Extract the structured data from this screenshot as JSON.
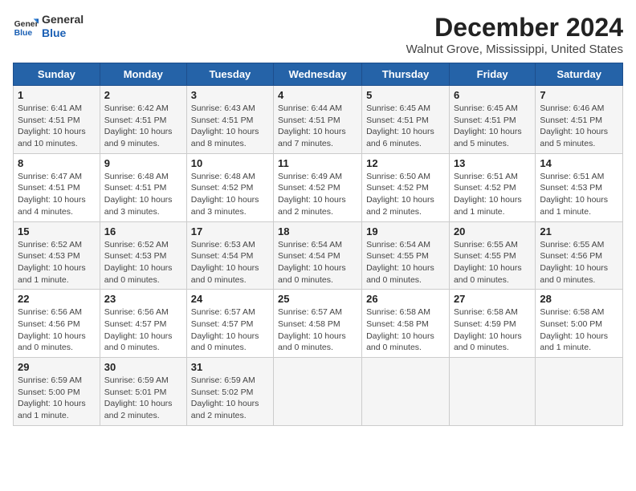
{
  "header": {
    "logo_line1": "General",
    "logo_line2": "Blue",
    "title": "December 2024",
    "subtitle": "Walnut Grove, Mississippi, United States"
  },
  "weekdays": [
    "Sunday",
    "Monday",
    "Tuesday",
    "Wednesday",
    "Thursday",
    "Friday",
    "Saturday"
  ],
  "weeks": [
    [
      {
        "day": "1",
        "info": "Sunrise: 6:41 AM\nSunset: 4:51 PM\nDaylight: 10 hours\nand 10 minutes."
      },
      {
        "day": "2",
        "info": "Sunrise: 6:42 AM\nSunset: 4:51 PM\nDaylight: 10 hours\nand 9 minutes."
      },
      {
        "day": "3",
        "info": "Sunrise: 6:43 AM\nSunset: 4:51 PM\nDaylight: 10 hours\nand 8 minutes."
      },
      {
        "day": "4",
        "info": "Sunrise: 6:44 AM\nSunset: 4:51 PM\nDaylight: 10 hours\nand 7 minutes."
      },
      {
        "day": "5",
        "info": "Sunrise: 6:45 AM\nSunset: 4:51 PM\nDaylight: 10 hours\nand 6 minutes."
      },
      {
        "day": "6",
        "info": "Sunrise: 6:45 AM\nSunset: 4:51 PM\nDaylight: 10 hours\nand 5 minutes."
      },
      {
        "day": "7",
        "info": "Sunrise: 6:46 AM\nSunset: 4:51 PM\nDaylight: 10 hours\nand 5 minutes."
      }
    ],
    [
      {
        "day": "8",
        "info": "Sunrise: 6:47 AM\nSunset: 4:51 PM\nDaylight: 10 hours\nand 4 minutes."
      },
      {
        "day": "9",
        "info": "Sunrise: 6:48 AM\nSunset: 4:51 PM\nDaylight: 10 hours\nand 3 minutes."
      },
      {
        "day": "10",
        "info": "Sunrise: 6:48 AM\nSunset: 4:52 PM\nDaylight: 10 hours\nand 3 minutes."
      },
      {
        "day": "11",
        "info": "Sunrise: 6:49 AM\nSunset: 4:52 PM\nDaylight: 10 hours\nand 2 minutes."
      },
      {
        "day": "12",
        "info": "Sunrise: 6:50 AM\nSunset: 4:52 PM\nDaylight: 10 hours\nand 2 minutes."
      },
      {
        "day": "13",
        "info": "Sunrise: 6:51 AM\nSunset: 4:52 PM\nDaylight: 10 hours\nand 1 minute."
      },
      {
        "day": "14",
        "info": "Sunrise: 6:51 AM\nSunset: 4:53 PM\nDaylight: 10 hours\nand 1 minute."
      }
    ],
    [
      {
        "day": "15",
        "info": "Sunrise: 6:52 AM\nSunset: 4:53 PM\nDaylight: 10 hours\nand 1 minute."
      },
      {
        "day": "16",
        "info": "Sunrise: 6:52 AM\nSunset: 4:53 PM\nDaylight: 10 hours\nand 0 minutes."
      },
      {
        "day": "17",
        "info": "Sunrise: 6:53 AM\nSunset: 4:54 PM\nDaylight: 10 hours\nand 0 minutes."
      },
      {
        "day": "18",
        "info": "Sunrise: 6:54 AM\nSunset: 4:54 PM\nDaylight: 10 hours\nand 0 minutes."
      },
      {
        "day": "19",
        "info": "Sunrise: 6:54 AM\nSunset: 4:55 PM\nDaylight: 10 hours\nand 0 minutes."
      },
      {
        "day": "20",
        "info": "Sunrise: 6:55 AM\nSunset: 4:55 PM\nDaylight: 10 hours\nand 0 minutes."
      },
      {
        "day": "21",
        "info": "Sunrise: 6:55 AM\nSunset: 4:56 PM\nDaylight: 10 hours\nand 0 minutes."
      }
    ],
    [
      {
        "day": "22",
        "info": "Sunrise: 6:56 AM\nSunset: 4:56 PM\nDaylight: 10 hours\nand 0 minutes."
      },
      {
        "day": "23",
        "info": "Sunrise: 6:56 AM\nSunset: 4:57 PM\nDaylight: 10 hours\nand 0 minutes."
      },
      {
        "day": "24",
        "info": "Sunrise: 6:57 AM\nSunset: 4:57 PM\nDaylight: 10 hours\nand 0 minutes."
      },
      {
        "day": "25",
        "info": "Sunrise: 6:57 AM\nSunset: 4:58 PM\nDaylight: 10 hours\nand 0 minutes."
      },
      {
        "day": "26",
        "info": "Sunrise: 6:58 AM\nSunset: 4:58 PM\nDaylight: 10 hours\nand 0 minutes."
      },
      {
        "day": "27",
        "info": "Sunrise: 6:58 AM\nSunset: 4:59 PM\nDaylight: 10 hours\nand 0 minutes."
      },
      {
        "day": "28",
        "info": "Sunrise: 6:58 AM\nSunset: 5:00 PM\nDaylight: 10 hours\nand 1 minute."
      }
    ],
    [
      {
        "day": "29",
        "info": "Sunrise: 6:59 AM\nSunset: 5:00 PM\nDaylight: 10 hours\nand 1 minute."
      },
      {
        "day": "30",
        "info": "Sunrise: 6:59 AM\nSunset: 5:01 PM\nDaylight: 10 hours\nand 2 minutes."
      },
      {
        "day": "31",
        "info": "Sunrise: 6:59 AM\nSunset: 5:02 PM\nDaylight: 10 hours\nand 2 minutes."
      },
      {
        "day": "",
        "info": ""
      },
      {
        "day": "",
        "info": ""
      },
      {
        "day": "",
        "info": ""
      },
      {
        "day": "",
        "info": ""
      }
    ]
  ]
}
